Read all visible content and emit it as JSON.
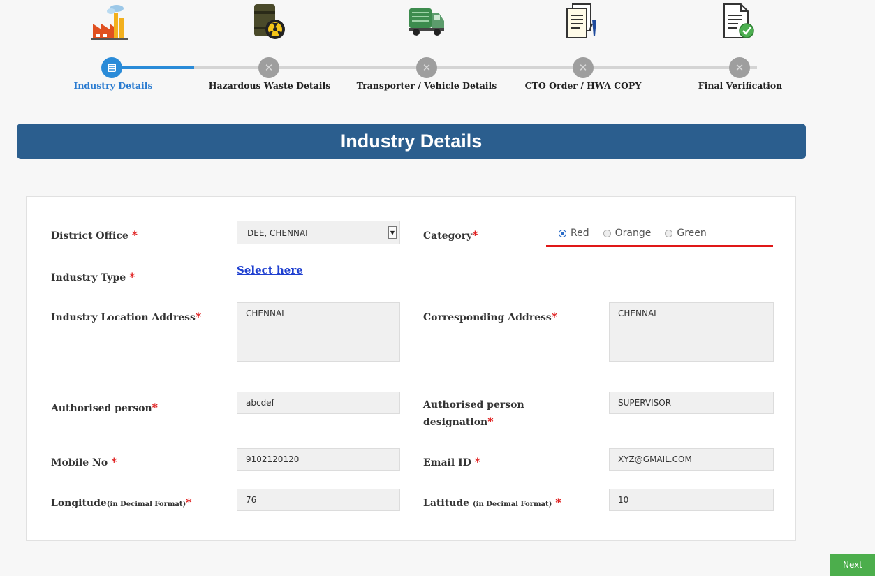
{
  "stepper": {
    "steps": [
      {
        "label": "Industry Details",
        "icon": "factory-icon",
        "state": "active"
      },
      {
        "label": "Hazardous Waste Details",
        "icon": "waste-barrel-icon",
        "state": "inactive"
      },
      {
        "label": "Transporter / Vehicle Details",
        "icon": "truck-icon",
        "state": "inactive"
      },
      {
        "label": "CTO Order / HWA COPY",
        "icon": "documents-icon",
        "state": "inactive"
      },
      {
        "label": "Final Verification",
        "icon": "verified-document-icon",
        "state": "inactive"
      }
    ]
  },
  "banner": {
    "title": "Industry Details"
  },
  "form": {
    "district_office": {
      "label": "District Office",
      "value": "DEE, CHENNAI"
    },
    "category": {
      "label": "Category",
      "options": [
        "Red",
        "Orange",
        "Green"
      ],
      "selected": "Red"
    },
    "industry_type": {
      "label": "Industry Type",
      "link": "Select here"
    },
    "industry_location": {
      "label": "Industry Location Address",
      "value": "CHENNAI"
    },
    "corresponding_address": {
      "label": "Corresponding Address",
      "value": "CHENNAI"
    },
    "authorised_person": {
      "label": "Authorised person",
      "value": "abcdef"
    },
    "designation": {
      "label_line1": "Authorised person",
      "label_line2": "designation",
      "value": "SUPERVISOR"
    },
    "mobile": {
      "label": "Mobile No",
      "value": "9102120120"
    },
    "email": {
      "label": "Email ID",
      "value": "XYZ@GMAIL.COM"
    },
    "longitude": {
      "label": "Longitude",
      "hint": "(in Decimal Format)",
      "value": "76"
    },
    "latitude": {
      "label": "Latitude",
      "hint": "(in Decimal Format)",
      "value": "10"
    },
    "required_mark": "*"
  },
  "actions": {
    "next_label": "Next"
  },
  "colors": {
    "accent": "#2a8bd8",
    "banner": "#2b5e8e",
    "required": "#e02020",
    "next": "#4cae4c"
  }
}
